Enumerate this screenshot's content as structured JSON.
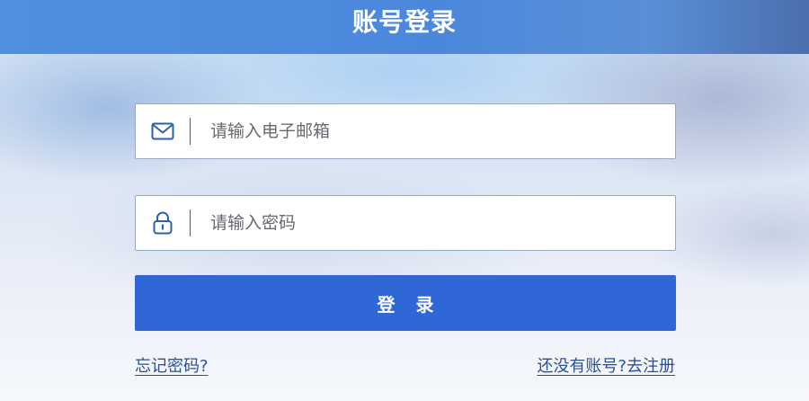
{
  "header": {
    "title": "账号登录"
  },
  "form": {
    "email": {
      "placeholder": "请输入电子邮箱",
      "value": "",
      "icon": "mail-icon"
    },
    "password": {
      "placeholder": "请输入密码",
      "value": "",
      "icon": "lock-icon"
    },
    "submit_label": "登 录"
  },
  "links": {
    "forgot_password": "忘记密码?",
    "register": "还没有账号?去注册"
  },
  "colors": {
    "header": "#4b88dc",
    "button": "#2f67d6",
    "link": "#2a4f9a",
    "icon": "#2f5fa8"
  }
}
